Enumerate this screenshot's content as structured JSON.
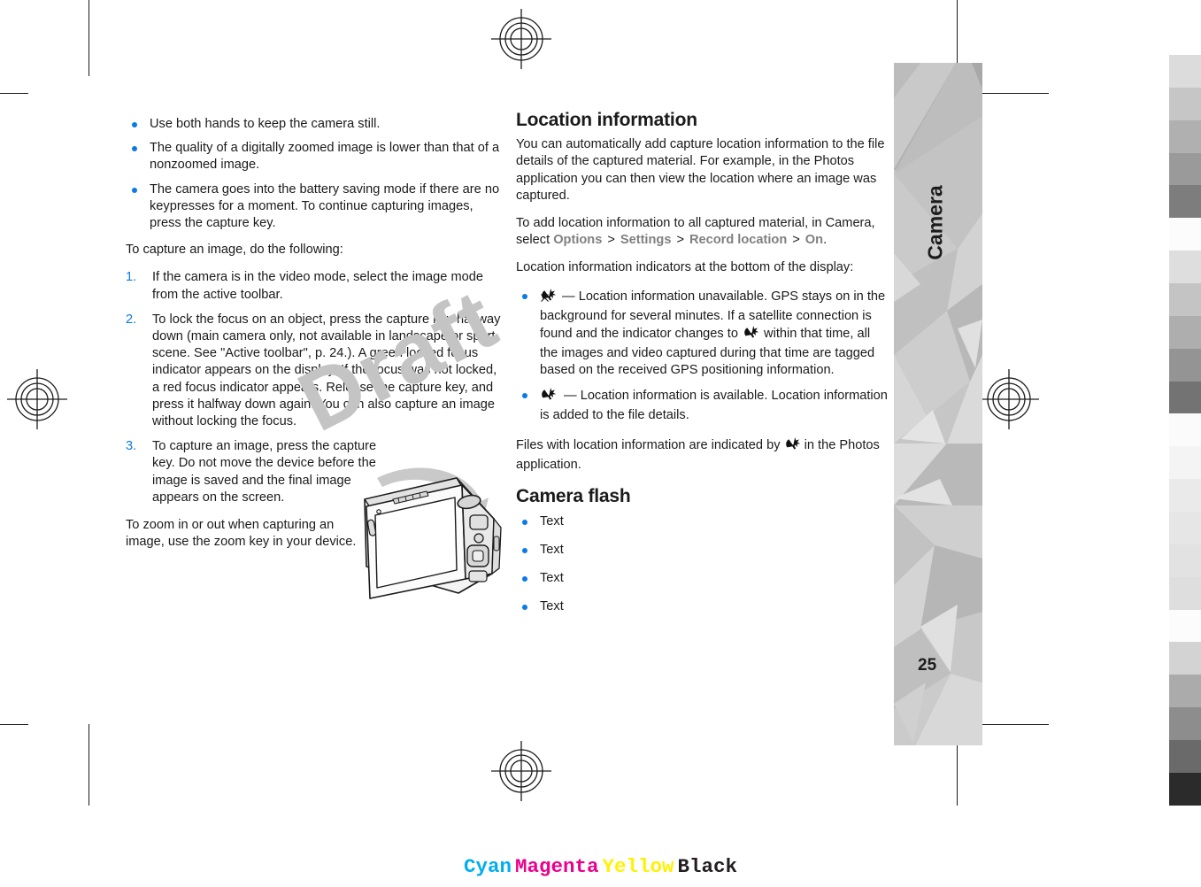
{
  "document": {
    "chapter": "Camera",
    "page_number": "25"
  },
  "left_column": {
    "tips": [
      "Use both hands to keep the camera still.",
      "The quality of a digitally zoomed image is lower than that of a nonzoomed image.",
      "The camera goes into the battery saving mode if there are no keypresses for a moment. To continue capturing images, press the capture key."
    ],
    "intro": "To capture an image, do the following:",
    "steps": [
      {
        "num": "1.",
        "text": "If the camera is in the video mode, select the image mode from the active toolbar."
      },
      {
        "num": "2.",
        "text": "To lock the focus on an object, press the capture key halfway down (main camera only, not available in landscape or sport scene. See \"Active toolbar\", p. 24.). A green locked focus indicator appears on the display. If the focus was not locked, a red focus indicator appears. Release the capture key, and press it halfway down again. You can also capture an image without locking the focus."
      },
      {
        "num": "3.",
        "text": "To capture an image, press the capture key. Do not move the device before the image is saved and the final image appears on the screen."
      }
    ],
    "closing": "To zoom in or out when capturing an image, use the zoom key in your device."
  },
  "right_column": {
    "heading_location": "Location information",
    "para1": "You can automatically add capture location information to the file details of the captured material. For example, in the Photos application you can then view the location where an image was captured.",
    "para2_pre": "To add location information to all captured material, in Camera, select ",
    "ui_options": "Options",
    "ui_settings": "Settings",
    "ui_record_location": "Record location",
    "ui_on": "On",
    "ui_separator": ">",
    "para2_post": ".",
    "para3": "Location information indicators at the bottom of the display:",
    "indicators": [
      {
        "icon": "gps-unavailable-icon",
        "text_pre": " — Location information unavailable. GPS stays on in the background for several minutes. If a satellite connection is found and the indicator changes to ",
        "icon_inline": "gps-available-icon",
        "text_post": " within that time, all the images and video captured during that time are tagged based on the received GPS positioning information."
      },
      {
        "icon": "gps-available-icon",
        "text_pre": " — Location information is available. Location information is added to the file details.",
        "icon_inline": "",
        "text_post": ""
      }
    ],
    "files_note_pre": "Files with location information are indicated by ",
    "files_note_icon": "gps-available-icon",
    "files_note_post": " in the Photos application.",
    "heading_flash": "Camera flash",
    "flash_items": [
      "Text",
      "Text",
      "Text",
      "Text"
    ]
  },
  "watermark": {
    "text": "Draft"
  },
  "print_marks": {
    "cmyk": [
      {
        "label": "Cyan",
        "color": "#00AEEF"
      },
      {
        "label": "Magenta",
        "color": "#EC008C"
      },
      {
        "label": "Yellow",
        "color": "#FFF200"
      },
      {
        "label": "Black",
        "color": "#231F20"
      }
    ],
    "gray_strip": [
      "#dcdcdc",
      "#c6c6c6",
      "#b0b0b0",
      "#9a9a9a",
      "#7d7d7d",
      "#fcfcfc",
      "#dedede",
      "#c4c4c4",
      "#aeaeae",
      "#949494",
      "#737373",
      "#fbfbfb",
      "#f4f4f4",
      "#eaeaea",
      "#e6e6e6",
      "#e2e2e2",
      "#dedede",
      "#fcfcfc",
      "#d3d3d3",
      "#ababab",
      "#8d8d8d",
      "#6a6a6a",
      "#2b2b2b"
    ]
  },
  "colors": {
    "bullet_blue": "#0b7ae5",
    "ui_term_gray": "#808080",
    "text_black": "#1a1a1a"
  }
}
